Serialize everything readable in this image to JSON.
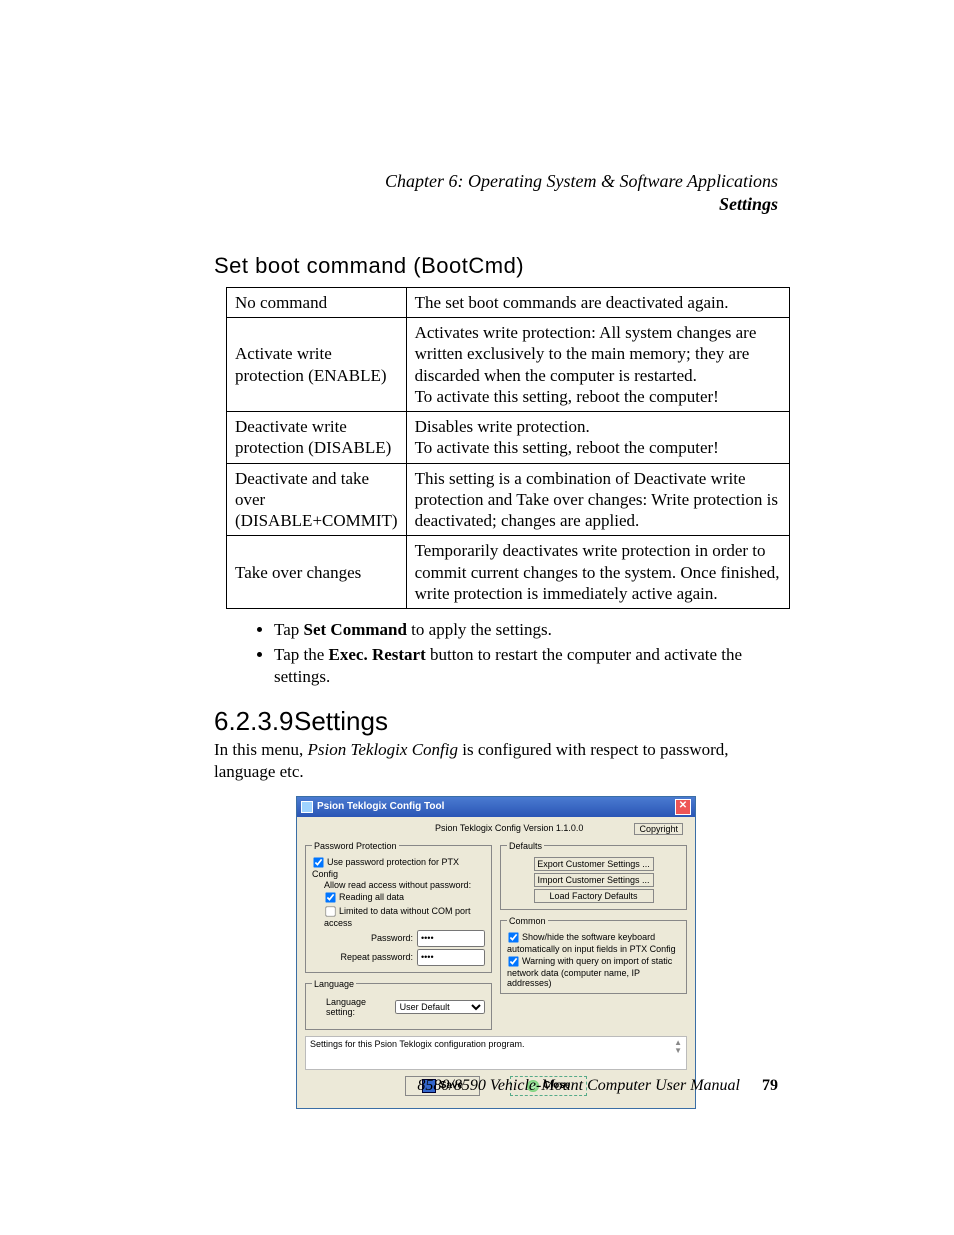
{
  "header": {
    "chapter_line": "Chapter  6:  Operating System & Software Applications",
    "section_line": "Settings"
  },
  "sub_heading": "Set boot command (BootCmd)",
  "table": {
    "rows": [
      {
        "key": "No command",
        "val": "The set boot commands are deactivated again."
      },
      {
        "key": "Activate write protection (ENABLE)",
        "val": "Activates write protection: All system changes are written exclusively to the main memory; they are discarded when the computer is restarted.\nTo activate this setting, reboot the computer!"
      },
      {
        "key": "Deactivate write protection (DISABLE)",
        "val": "Disables write protection.\nTo activate this setting, reboot the computer!"
      },
      {
        "key": "Deactivate and take over (DISABLE+COMMIT)",
        "val": "This setting is a combination of Deactivate write protection and Take over changes: Write protection is deactivated; changes are applied."
      },
      {
        "key": "Take over changes",
        "val": "Temporarily deactivates write protection in order to commit current changes to the system. Once finished, write protection is immediately active again."
      }
    ]
  },
  "bullets": {
    "b1_pre": "Tap ",
    "b1_bold": "Set Command",
    "b1_post": " to apply the settings.",
    "b2_pre": "Tap the ",
    "b2_bold": "Exec. Restart",
    "b2_post": " button to restart the computer and activate the settings."
  },
  "section": {
    "num": "6.2.3.9",
    "title": "Settings",
    "p_pre": "In this menu, ",
    "p_italic": "Psion Teklogix Config",
    "p_post": " is configured with respect to password, language etc."
  },
  "dialog": {
    "title": "Psion Teklogix Config Tool",
    "version": "Psion Teklogix Config Version 1.1.0.0",
    "copyright": "Copyright",
    "group_pw": "Password Protection",
    "cb_usepw": "Use password protection for PTX Config",
    "lbl_allow": "Allow read access without password:",
    "cb_read_all": "Reading all data",
    "cb_limited": "Limited to data without COM port access",
    "lbl_pw": "Password:",
    "lbl_pw2": "Repeat password:",
    "pw_val": "••••",
    "group_lang": "Language",
    "lbl_lang": "Language setting:",
    "lang_val": "User Default",
    "group_defaults": "Defaults",
    "btn_export": "Export Customer Settings ...",
    "btn_import": "Import Customer Settings ...",
    "btn_factory": "Load Factory Defaults",
    "group_common": "Common",
    "cb_kb": "Show/hide the software keyboard automatically on input fields in PTX Config",
    "cb_warn": "Warning with query on import of static network data (computer name, IP addresses)",
    "desc": "Settings for this Psion Teklogix configuration program.",
    "btn_save": "Save",
    "btn_close": "Close"
  },
  "footer": {
    "manual": "8580/8590 Vehicle-Mount Computer User Manual",
    "page": "79"
  }
}
